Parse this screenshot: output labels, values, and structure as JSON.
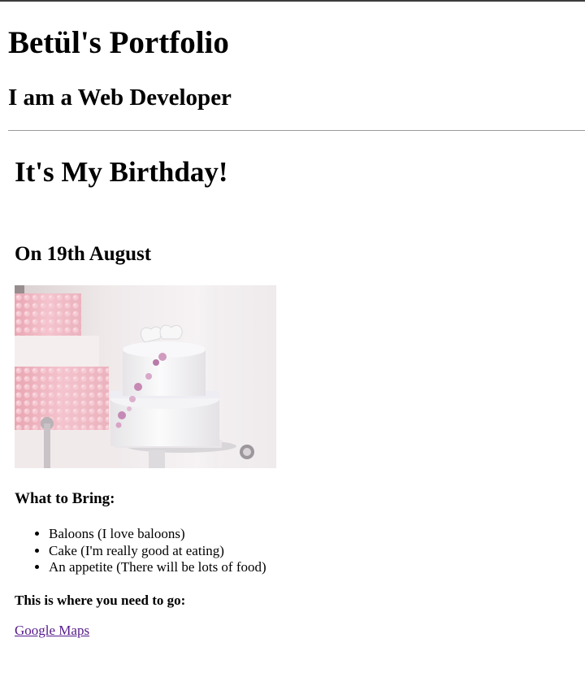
{
  "header": {
    "title": "Betül's Portfolio",
    "subtitle": "I am a Web Developer"
  },
  "main": {
    "heading": "It's My Birthday!",
    "date_heading": "On 19th August",
    "image": {
      "icon": "birthday-cake-photo"
    },
    "bring_heading": "What to Bring:",
    "bring_items": [
      "Baloons (I love baloons)",
      "Cake (I'm really good at eating)",
      "An appetite (There will be lots of food)"
    ],
    "location_heading": "This is where you need to go:",
    "map_link": "Google Maps"
  },
  "colors": {
    "visited_link": "#551a8b",
    "divider": "#9a9a9a"
  }
}
